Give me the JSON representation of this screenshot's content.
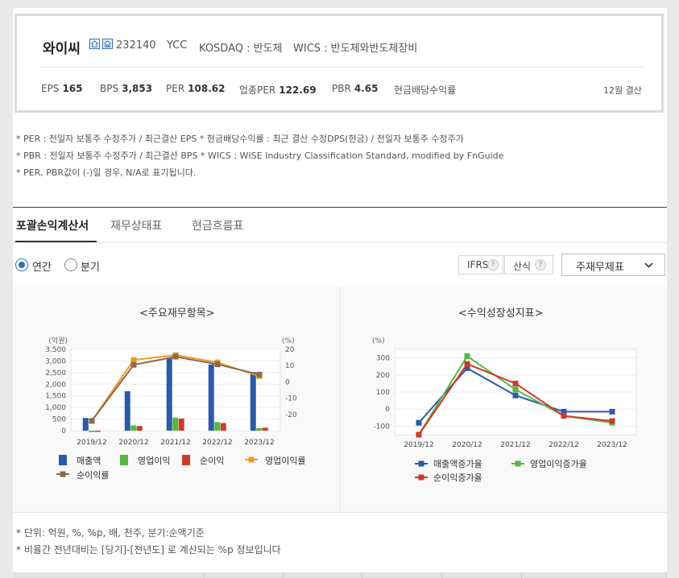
{
  "header": {
    "company_name": "와이씨",
    "ticker": "232140",
    "english_name": "YCC",
    "market": "KOSDAQ : 반도체",
    "wics": "WICS : 반도체와반도체장비",
    "fiscal_note": "12월 결산",
    "icons": [
      "home-icon",
      "building-icon"
    ]
  },
  "metrics": [
    {
      "label": "EPS",
      "value": "165"
    },
    {
      "label": "BPS",
      "value": "3,853"
    },
    {
      "label": "PER",
      "value": "108.62"
    },
    {
      "label": "업종PER",
      "value": "122.69"
    },
    {
      "label": "PBR",
      "value": "4.65"
    },
    {
      "label": "현금배당수익률",
      "value": ""
    }
  ],
  "notes": [
    "* PER : 전일자 보통주 수정주가 / 최근결산 EPS * 현금배당수익률 : 최근 결산 수정DPS(현금) / 전일자 보통주 수정주가",
    "* PBR : 전일자 보통주 수정주가 / 최근결산 BPS * WICS : WISE Industry Classification Standard, modified by FnGuide",
    "* PER, PBR값이 (-)일 경우, N/A로 표기됩니다."
  ],
  "tabs": [
    {
      "label": "포괄손익계산서",
      "active": true
    },
    {
      "label": "재무상태표",
      "active": false
    },
    {
      "label": "현금흐름표",
      "active": false
    }
  ],
  "period_options": [
    {
      "label": "연간",
      "checked": true
    },
    {
      "label": "분기",
      "checked": false
    }
  ],
  "toolbar": {
    "ifrs_label": "IFRS",
    "calc_label": "산식",
    "help_glyph": "?",
    "statement_select": "주재무제표"
  },
  "chart_data": [
    {
      "type": "bar",
      "title": "<주요재무항목>",
      "ylabel_left": "(억원)",
      "ylabel_right": "(%)",
      "categories": [
        "2019/12",
        "2020/12",
        "2021/12",
        "2022/12",
        "2023/12"
      ],
      "ylim_left": [
        0,
        3500
      ],
      "yticks_left": [
        "3,500",
        "3,000",
        "2,500",
        "2,000",
        "1,500",
        "1,000",
        "500",
        "0"
      ],
      "ylim_right": [
        -30,
        20
      ],
      "yticks_right": [
        "20",
        "10",
        "0",
        "-10",
        "-20"
      ],
      "series": [
        {
          "name": "매출액",
          "kind": "bar",
          "axis": "left",
          "color": "#2b5ba8",
          "values": [
            550,
            1700,
            3120,
            2850,
            2520
          ]
        },
        {
          "name": "영업이익",
          "kind": "bar",
          "axis": "left",
          "color": "#55b840",
          "values": [
            -60,
            230,
            560,
            370,
            110
          ]
        },
        {
          "name": "순이익",
          "kind": "bar",
          "axis": "left",
          "color": "#cf3a2a",
          "values": [
            -50,
            200,
            520,
            330,
            130
          ]
        },
        {
          "name": "영업이익률",
          "kind": "line",
          "axis": "right",
          "color": "#f39a1e",
          "values": [
            -24,
            13.5,
            16.5,
            12,
            3.5
          ]
        },
        {
          "name": "순이익률",
          "kind": "line",
          "axis": "right",
          "color": "#8a6a4e",
          "values": [
            -24,
            10.5,
            15.5,
            10.8,
            4.5
          ]
        }
      ],
      "legend_position": "bottom"
    },
    {
      "type": "line",
      "title": "<수익성장성지표>",
      "ylabel": "(%)",
      "categories": [
        "2019/12",
        "2020/12",
        "2021/12",
        "2022/12",
        "2023/12"
      ],
      "ylim": [
        -150,
        350
      ],
      "yticks": [
        "300",
        "200",
        "100",
        "0",
        "-100"
      ],
      "series": [
        {
          "name": "매출액증가율",
          "color": "#2b5ba8",
          "values": [
            -80,
            240,
            80,
            -15,
            -15
          ]
        },
        {
          "name": "영업이익증가율",
          "color": "#55b840",
          "values": [
            -150,
            310,
            115,
            -40,
            -80
          ]
        },
        {
          "name": "순이익증가율",
          "color": "#cf3a2a",
          "values": [
            -150,
            265,
            150,
            -40,
            -70
          ]
        }
      ],
      "legend_position": "bottom"
    }
  ],
  "bottom_notes": [
    "* 단위: 억원, %, %p, 배, 천주, 분기:순액기준",
    "* 비율간 전년대비는 [당기]-[전년도] 로 계산되는 %p 정보입니다"
  ]
}
